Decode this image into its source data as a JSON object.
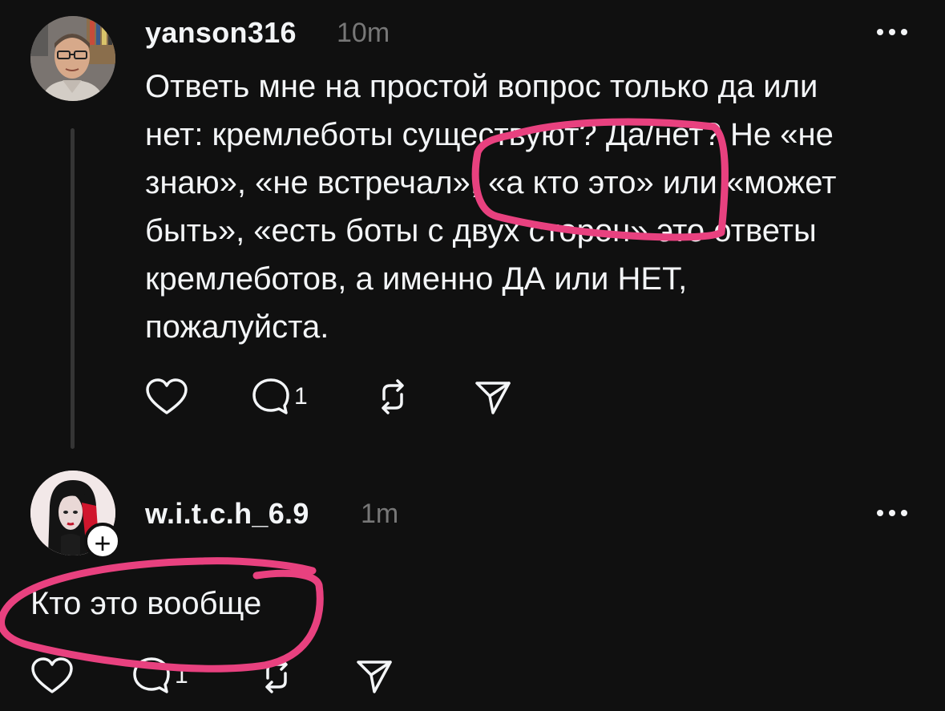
{
  "posts": [
    {
      "username": "yanson316",
      "time": "10m",
      "text": "Ответь мне на простой вопрос только да или\nнет: кремлеботы существуют? Да/нет?  Не «не\nзнаю», «не встречал», «а кто это» или «может\nбыть», «есть боты с двух сторон» это ответы\nкремлеботов, а именно ДА или НЕТ,\nпожалуйста.",
      "reply_count": "1",
      "avatar_icon": "user-photo-avatar",
      "more_icon": "more-options-icon"
    },
    {
      "username": "w.i.t.c.h_6.9",
      "time": "1m",
      "text": "Кто это вообще",
      "reply_count": "1",
      "avatar_icon": "illustrated-girl-avatar",
      "follow_icon": "plus-icon",
      "follow_label": "+"
    }
  ],
  "colors": {
    "background": "#101010",
    "text": "#f3f5f7",
    "muted": "#777777",
    "annotation": "#e8417f"
  }
}
